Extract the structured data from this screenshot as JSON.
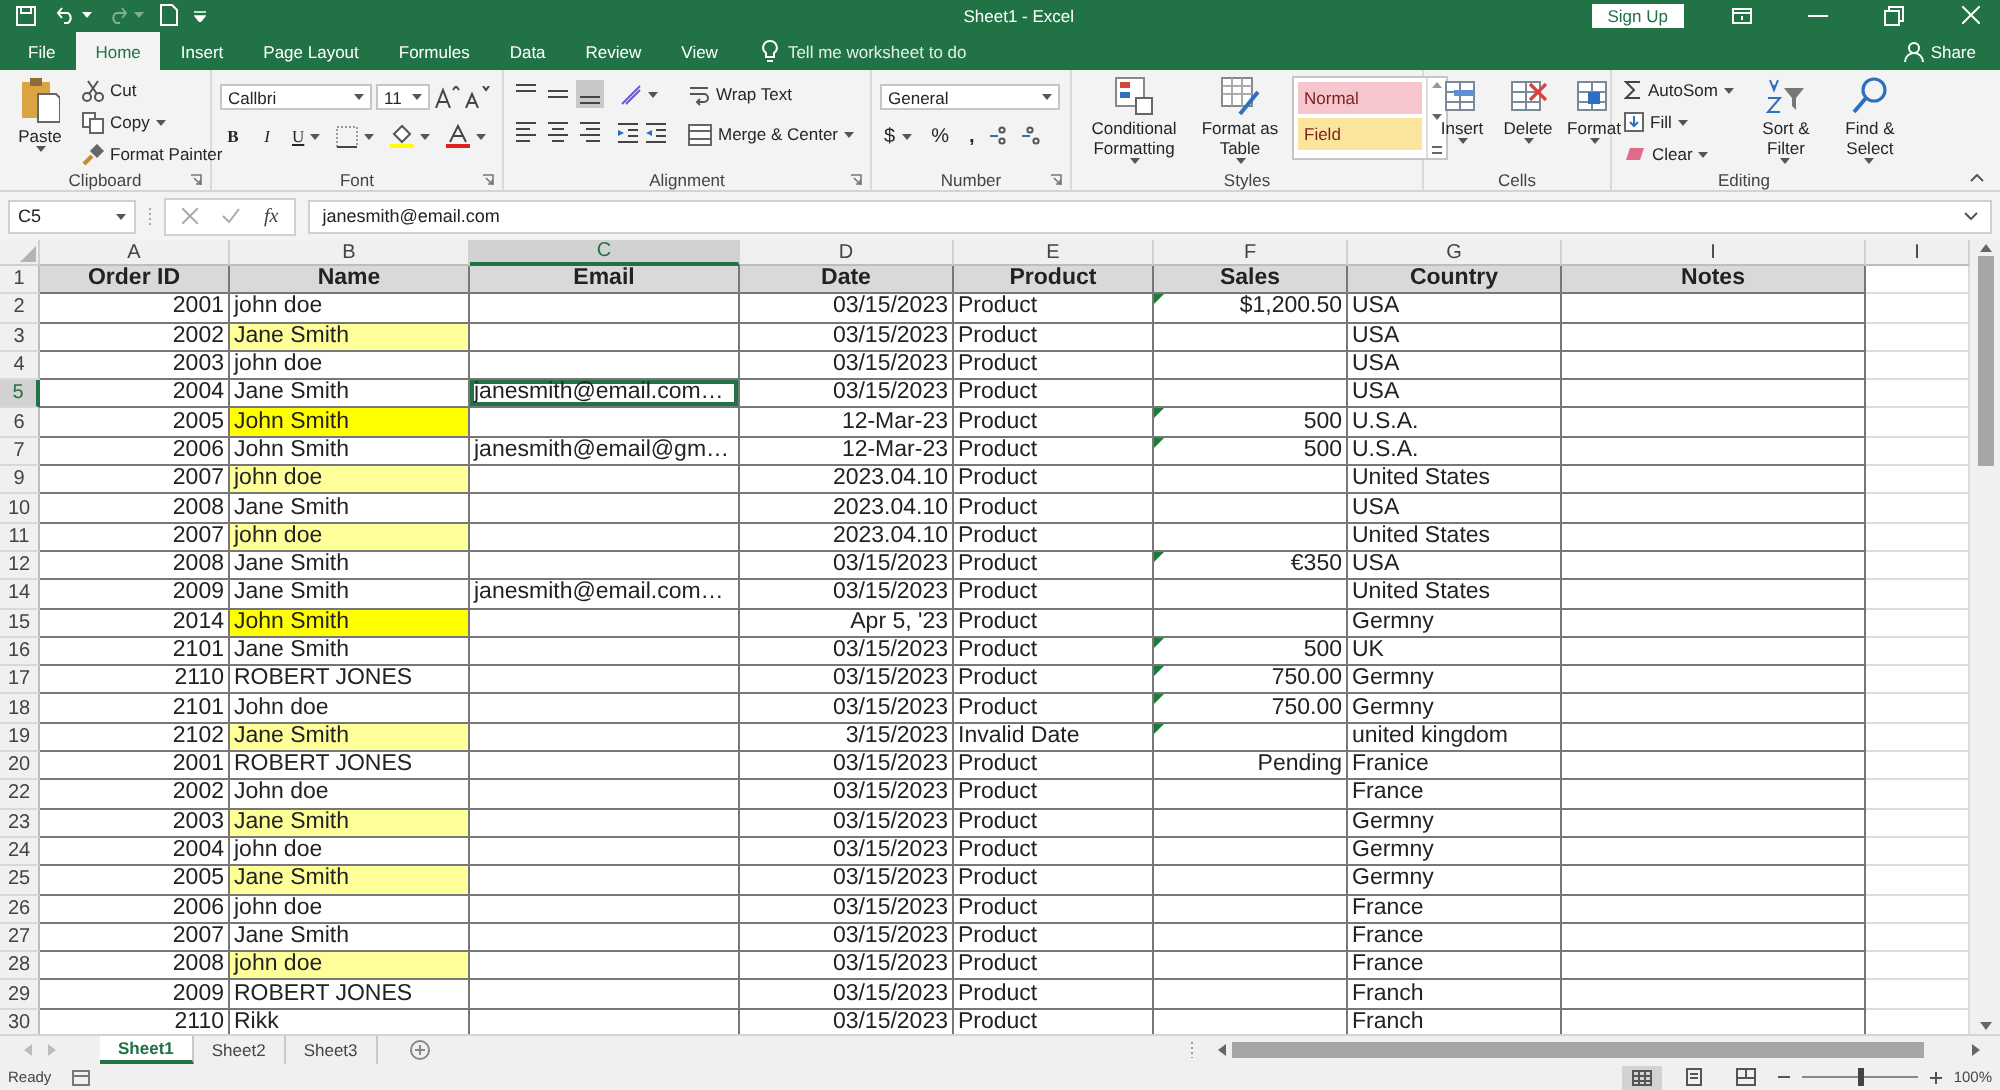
{
  "window": {
    "title": "Sheet1 - Excel",
    "sign_up": "Sign Up"
  },
  "ribbon_tabs": [
    {
      "label": "File",
      "selected": false
    },
    {
      "label": "Home",
      "selected": true
    },
    {
      "label": "Insert",
      "selected": false
    },
    {
      "label": "Page Layout",
      "selected": false
    },
    {
      "label": "Formules",
      "selected": false
    },
    {
      "label": "Data",
      "selected": false
    },
    {
      "label": "Review",
      "selected": false
    },
    {
      "label": "View",
      "selected": false
    }
  ],
  "tell_me": "Tell me worksheet to do",
  "share": "Share",
  "clipboard": {
    "label": "Clipboard",
    "paste": "Paste",
    "cut": "Cut",
    "copy": "Copy",
    "format_painter": "Format Painter"
  },
  "font": {
    "label": "Font",
    "name": "Callbri",
    "size": "11",
    "bold": "B",
    "italic": "I",
    "underline": "U"
  },
  "alignment": {
    "label": "Alignment",
    "align_buttons": [
      {
        "kind": "top",
        "selected": false
      },
      {
        "kind": "middle",
        "selected": false
      },
      {
        "kind": "bottom",
        "selected": true
      },
      {
        "kind": "left",
        "selected": false
      },
      {
        "kind": "center",
        "selected": false
      },
      {
        "kind": "right",
        "selected": false
      }
    ],
    "wrap_text": "Wrap Text",
    "merge_center": "Merge & Center"
  },
  "number": {
    "label": "Number",
    "format": "General",
    "currency": "$",
    "percent": "%",
    "comma": ","
  },
  "styles": {
    "label": "Styles",
    "conditional": "Conditional Formatting",
    "format_table": "Format as Table",
    "cell_styles": [
      {
        "label": "Normal",
        "color": "#f6c6cc"
      },
      {
        "label": "Field",
        "color": "#fbe49c"
      }
    ]
  },
  "cells": {
    "label": "Cells",
    "buttons": [
      "Insert",
      "Delete",
      "Format"
    ]
  },
  "editing": {
    "label": "Editing",
    "autosum": "AutoSom",
    "fill": "Fill",
    "clear": "Clear",
    "sort": "Sort & Filter",
    "find": "Find & Select"
  },
  "formula_bar": {
    "name_box": "C5",
    "fx": "fx",
    "formula": "janesmith@email.com"
  },
  "columns": [
    {
      "label": "A",
      "selected": false
    },
    {
      "label": "B",
      "selected": false
    },
    {
      "label": "C",
      "selected": true
    },
    {
      "label": "D",
      "selected": false
    },
    {
      "label": "E",
      "selected": false
    },
    {
      "label": "F",
      "selected": false
    },
    {
      "label": "G",
      "selected": false
    },
    {
      "label": "I",
      "selected": false
    },
    {
      "label": "I",
      "selected": false
    }
  ],
  "header_row": {
    "row": "1",
    "cells": [
      "Order ID",
      "Name",
      "Email",
      "Date",
      "Product",
      "Sales",
      "Country",
      "Notes"
    ]
  },
  "rows": [
    {
      "row": "2",
      "order_id": "2001",
      "name": "john doe",
      "date": "03/15/2023",
      "product": "Product",
      "sales": "$1,200.50",
      "flag": true,
      "country": "USA",
      "selected": false
    },
    {
      "row": "3",
      "order_id": "2002",
      "name": "Jane Smith",
      "color": "#ffff99",
      "date": "03/15/2023",
      "product": "Product",
      "flag": false,
      "country": "USA",
      "selected": false
    },
    {
      "row": "4",
      "order_id": "2003",
      "name": "john doe",
      "date": "03/15/2023",
      "product": "Product",
      "flag": false,
      "country": "USA",
      "selected": false
    },
    {
      "row": "5",
      "order_id": "2004",
      "name": "Jane Smith",
      "email": "janesmith@email.com…",
      "date": "03/15/2023",
      "product": "Product",
      "flag": false,
      "country": "USA",
      "selected": true
    },
    {
      "row": "6",
      "order_id": "2005",
      "name": "John Smith",
      "color": "#ffff00",
      "date": "12-Mar-23",
      "product": "Product",
      "sales": "500",
      "flag": true,
      "country": "U.S.A.",
      "selected": false
    },
    {
      "row": "7",
      "order_id": "2006",
      "name": "John Smith",
      "email": "janesmith@email@gm…",
      "date": "12-Mar-23",
      "product": "Product",
      "sales": "500",
      "flag": true,
      "country": "U.S.A.",
      "selected": false
    },
    {
      "row": "9",
      "order_id": "2007",
      "name": "john doe",
      "color": "#ffff99",
      "date": "2023.04.10",
      "product": "Product",
      "flag": false,
      "country": "United States",
      "selected": false
    },
    {
      "row": "10",
      "order_id": "2008",
      "name": "Jane Smith",
      "date": "2023.04.10",
      "product": "Product",
      "flag": false,
      "country": "USA",
      "selected": false
    },
    {
      "row": "11",
      "order_id": "2007",
      "name": "john doe",
      "color": "#ffff99",
      "date": "2023.04.10",
      "product": "Product",
      "flag": false,
      "country": "United States",
      "selected": false
    },
    {
      "row": "12",
      "order_id": "2008",
      "name": "Jane Smith",
      "date": "03/15/2023",
      "product": "Product",
      "sales": "€350",
      "flag": true,
      "country": "USA",
      "selected": false
    },
    {
      "row": "14",
      "order_id": "2009",
      "name": "Jane Smith",
      "email": "janesmith@email.com…",
      "date": "03/15/2023",
      "product": "Product",
      "flag": false,
      "country": "United States",
      "selected": false
    },
    {
      "row": "15",
      "order_id": "2014",
      "name": "John Smith",
      "color": "#ffff00",
      "date": "Apr 5, '23",
      "product": "Product",
      "flag": false,
      "country": "Germny",
      "selected": false
    },
    {
      "row": "16",
      "order_id": "2101",
      "name": "Jane Smith",
      "date": "03/15/2023",
      "product": "Product",
      "sales": "500",
      "flag": true,
      "country": "UK",
      "selected": false
    },
    {
      "row": "17",
      "order_id": "2110",
      "name": "ROBERT JONES",
      "date": "03/15/2023",
      "product": "Product",
      "sales": "750.00",
      "flag": true,
      "country": "Germny",
      "selected": false
    },
    {
      "row": "18",
      "order_id": "2101",
      "name": "John doe",
      "date": "03/15/2023",
      "product": "Product",
      "sales": "750.00",
      "flag": true,
      "country": "Germny",
      "selected": false
    },
    {
      "row": "19",
      "order_id": "2102",
      "name": "Jane Smith",
      "color": "#ffff99",
      "date": "3/15/2023",
      "product": "Invalid Date",
      "flag": true,
      "country": "united kingdom",
      "selected": false
    },
    {
      "row": "20",
      "order_id": "2001",
      "name": "ROBERT JONES",
      "date": "03/15/2023",
      "product": "Product",
      "sales": "Pending",
      "flag": false,
      "country": "Franice",
      "selected": false
    },
    {
      "row": "22",
      "order_id": "2002",
      "name": "John doe",
      "date": "03/15/2023",
      "product": "Product",
      "flag": false,
      "country": "France",
      "selected": false
    },
    {
      "row": "23",
      "order_id": "2003",
      "name": "Jane Smith",
      "color": "#ffff99",
      "date": "03/15/2023",
      "product": "Product",
      "flag": false,
      "country": "Germny",
      "selected": false
    },
    {
      "row": "24",
      "order_id": "2004",
      "name": "john doe",
      "date": "03/15/2023",
      "product": "Product",
      "flag": false,
      "country": "Germny",
      "selected": false
    },
    {
      "row": "25",
      "order_id": "2005",
      "name": "Jane Smith",
      "color": "#ffff99",
      "date": "03/15/2023",
      "product": "Product",
      "flag": false,
      "country": "Germny",
      "selected": false
    },
    {
      "row": "26",
      "order_id": "2006",
      "name": "john doe",
      "date": "03/15/2023",
      "product": "Product",
      "flag": false,
      "country": "France",
      "selected": false
    },
    {
      "row": "27",
      "order_id": "2007",
      "name": "Jane Smith",
      "date": "03/15/2023",
      "product": "Product",
      "flag": false,
      "country": "France",
      "selected": false
    },
    {
      "row": "28",
      "order_id": "2008",
      "name": "john doe",
      "color": "#ffff99",
      "date": "03/15/2023",
      "product": "Product",
      "flag": false,
      "country": "France",
      "selected": false
    },
    {
      "row": "29",
      "order_id": "2009",
      "name": "ROBERT JONES",
      "date": "03/15/2023",
      "product": "Product",
      "flag": false,
      "country": "Franch",
      "selected": false
    },
    {
      "row": "30",
      "order_id": "2110",
      "name": "Rikk",
      "date": "03/15/2023",
      "product": "Product",
      "flag": false,
      "country": "Franch",
      "selected": false
    }
  ],
  "sheet_tabs": [
    {
      "label": "Sheet1",
      "selected": true
    },
    {
      "label": "Sheet2",
      "selected": false
    },
    {
      "label": "Sheet3",
      "selected": false
    }
  ],
  "status_bar": {
    "status": "Ready",
    "zoom": {
      "level": 0.5,
      "reading": "100%"
    }
  }
}
